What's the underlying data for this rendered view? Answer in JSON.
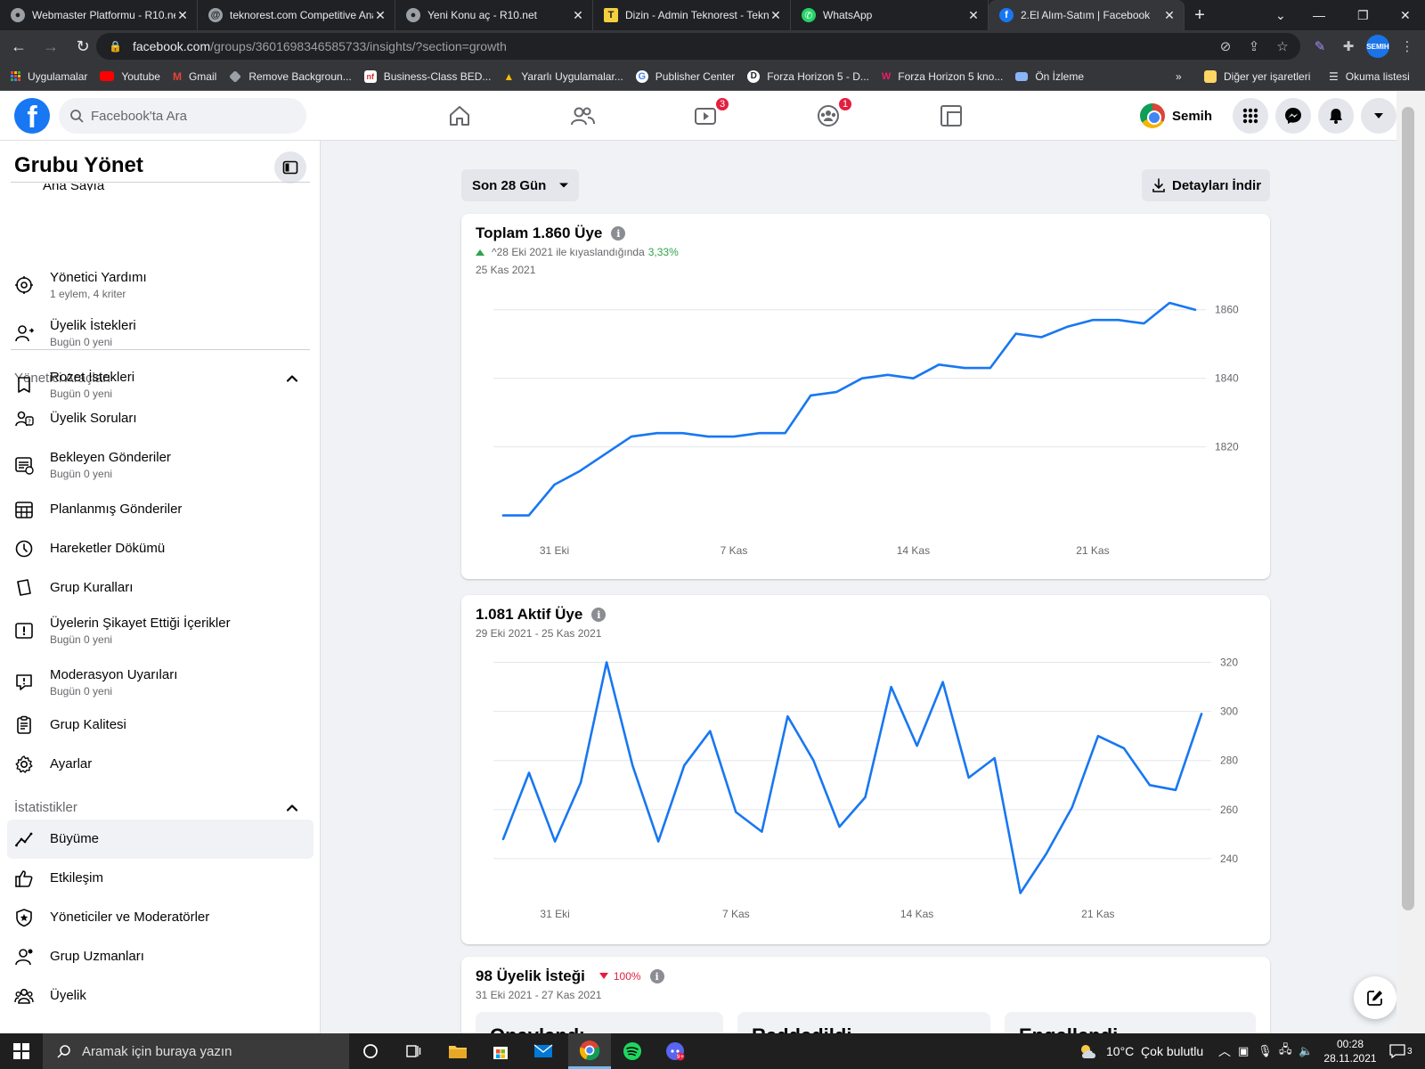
{
  "browser": {
    "tabs": [
      {
        "title": "Webmaster Platformu - R10.net",
        "icon": "r10-icon",
        "active": false
      },
      {
        "title": "teknorest.com Competitive Analysis",
        "icon": "at-sign-icon",
        "active": false
      },
      {
        "title": "Yeni Konu aç - R10.net",
        "icon": "r10-icon",
        "active": false
      },
      {
        "title": "Dizin - Admin Teknorest - Teknorest",
        "icon": "t-icon",
        "active": false
      },
      {
        "title": "WhatsApp",
        "icon": "whatsapp-icon",
        "active": false
      },
      {
        "title": "2.El Alım-Satım | Facebook",
        "icon": "facebook-icon",
        "active": true
      }
    ],
    "url_host": "facebook.com",
    "url_path": "/groups/3601698346585733/insights/?section=growth",
    "profile_badge": "SEMIH",
    "bookmarks": [
      {
        "label": "Uygulamalar",
        "color": "#ea4335"
      },
      {
        "label": "Youtube",
        "color": "#ff0000"
      },
      {
        "label": "Gmail",
        "color": "#ea4335"
      },
      {
        "label": "Remove Backgroun...",
        "color": "#9aa0a6"
      },
      {
        "label": "Business-Class BED...",
        "color": "#d93025"
      },
      {
        "label": "Yararlı Uygulamalar...",
        "color": "#fbbc04"
      },
      {
        "label": "Publisher Center",
        "color": "#4285f4"
      },
      {
        "label": "Forza Horizon 5 - D...",
        "color": "#ffffff"
      },
      {
        "label": "Forza Horizon 5 kno...",
        "color": "#e91e63"
      },
      {
        "label": "Ön İzleme",
        "color": "#8ab4f8"
      }
    ],
    "bookmarks_other": "Diğer yer işaretleri",
    "bookmarks_reading": "Okuma listesi"
  },
  "fb": {
    "search_placeholder": "Facebook'ta Ara",
    "watch_badge": "3",
    "groups_badge": "1",
    "profile_name": "Semih"
  },
  "sidebar": {
    "title": "Grubu Yönet",
    "home_label": "Ana Sayfa",
    "admin_section": "Yönetici Araçları",
    "admin_items": [
      {
        "label": "Yönetici Yardımı",
        "sub": "1 eylem, 4 kriter",
        "icon": "admin-assist-icon"
      },
      {
        "label": "Üyelik İstekleri",
        "sub": "Bugün 0 yeni",
        "icon": "member-request-icon"
      },
      {
        "label": "Rozet İstekleri",
        "sub": "Bugün 0 yeni",
        "icon": "badge-icon"
      },
      {
        "label": "Üyelik Soruları",
        "sub": "",
        "icon": "member-questions-icon"
      },
      {
        "label": "Bekleyen Gönderiler",
        "sub": "Bugün 0 yeni",
        "icon": "pending-posts-icon"
      },
      {
        "label": "Planlanmış Gönderiler",
        "sub": "",
        "icon": "calendar-icon"
      },
      {
        "label": "Hareketler Dökümü",
        "sub": "",
        "icon": "clock-icon"
      },
      {
        "label": "Grup Kuralları",
        "sub": "",
        "icon": "rules-icon"
      },
      {
        "label": "Üyelerin Şikayet Ettiği İçerikler",
        "sub": "Bugün 0 yeni",
        "icon": "report-icon"
      },
      {
        "label": "Moderasyon Uyarıları",
        "sub": "Bugün 0 yeni",
        "icon": "moderation-icon"
      },
      {
        "label": "Grup Kalitesi",
        "sub": "",
        "icon": "quality-icon"
      },
      {
        "label": "Ayarlar",
        "sub": "",
        "icon": "gear-icon"
      }
    ],
    "stats_section": "İstatistikler",
    "stats_items": [
      {
        "label": "Büyüme",
        "icon": "growth-icon",
        "active": true
      },
      {
        "label": "Etkileşim",
        "icon": "like-icon",
        "active": false
      },
      {
        "label": "Yöneticiler ve Moderatörler",
        "icon": "shield-icon",
        "active": false
      },
      {
        "label": "Grup Uzmanları",
        "icon": "experts-icon",
        "active": false
      },
      {
        "label": "Üyelik",
        "icon": "members-icon",
        "active": false
      }
    ]
  },
  "main": {
    "range_label": "Son 28 Gün",
    "download_label": "Detayları İndir",
    "total": {
      "title": "Toplam 1.860 Üye",
      "compare_text": "^28 Eki 2021 ile kıyaslandığında",
      "compare_value": "3,33%",
      "date": "25 Kas 2021"
    },
    "active": {
      "title": "1.081 Aktif Üye",
      "date": "29 Eki 2021 - 25 Kas 2021"
    },
    "requests": {
      "title": "98 Üyelik İsteği",
      "change": "100%",
      "date": "31 Eki 2021 - 27 Kas 2021",
      "sub_cards": [
        "Onaylandı",
        "Reddedildi",
        "Engellendi"
      ]
    }
  },
  "chart_data": [
    {
      "type": "line",
      "x": [
        "29 Eki",
        "30 Eki",
        "31 Eki",
        "1 Kas",
        "2 Kas",
        "3 Kas",
        "4 Kas",
        "5 Kas",
        "6 Kas",
        "7 Kas",
        "8 Kas",
        "9 Kas",
        "10 Kas",
        "11 Kas",
        "12 Kas",
        "13 Kas",
        "14 Kas",
        "15 Kas",
        "16 Kas",
        "17 Kas",
        "18 Kas",
        "19 Kas",
        "20 Kas",
        "21 Kas",
        "22 Kas",
        "23 Kas",
        "24 Kas",
        "25 Kas"
      ],
      "values": [
        1800,
        1800,
        1809,
        1813,
        1818,
        1823,
        1824,
        1824,
        1823,
        1823,
        1824,
        1824,
        1835,
        1836,
        1840,
        1841,
        1840,
        1844,
        1843,
        1843,
        1853,
        1852,
        1855,
        1857,
        1857,
        1856,
        1862,
        1860
      ],
      "x_ticks": [
        "31 Eki",
        "7 Kas",
        "14 Kas",
        "21 Kas"
      ],
      "y_ticks": [
        1820,
        1840,
        1860
      ],
      "ylim": [
        1796,
        1862
      ],
      "color": "#1877f2",
      "grid": true
    },
    {
      "type": "line",
      "x": [
        "29 Eki",
        "30 Eki",
        "31 Eki",
        "1 Kas",
        "2 Kas",
        "3 Kas",
        "4 Kas",
        "5 Kas",
        "6 Kas",
        "7 Kas",
        "8 Kas",
        "9 Kas",
        "10 Kas",
        "11 Kas",
        "12 Kas",
        "13 Kas",
        "14 Kas",
        "15 Kas",
        "16 Kas",
        "17 Kas",
        "18 Kas",
        "19 Kas",
        "20 Kas",
        "21 Kas",
        "22 Kas",
        "23 Kas",
        "24 Kas",
        "25 Kas"
      ],
      "values": [
        248,
        275,
        247,
        271,
        320,
        278,
        247,
        278,
        292,
        259,
        251,
        298,
        280,
        253,
        265,
        310,
        286,
        312,
        273,
        281,
        226,
        242,
        261,
        290,
        285,
        270,
        268,
        299
      ],
      "x_ticks": [
        "31 Eki",
        "7 Kas",
        "14 Kas",
        "21 Kas"
      ],
      "y_ticks": [
        240,
        260,
        280,
        300,
        320
      ],
      "ylim": [
        224,
        322
      ],
      "color": "#1877f2",
      "grid": true
    }
  ],
  "taskbar": {
    "search_placeholder": "Aramak için buraya yazın",
    "weather": "10°C  Çok bulutlu",
    "time": "00:28",
    "date": "28.11.2021",
    "notifications": "3"
  }
}
